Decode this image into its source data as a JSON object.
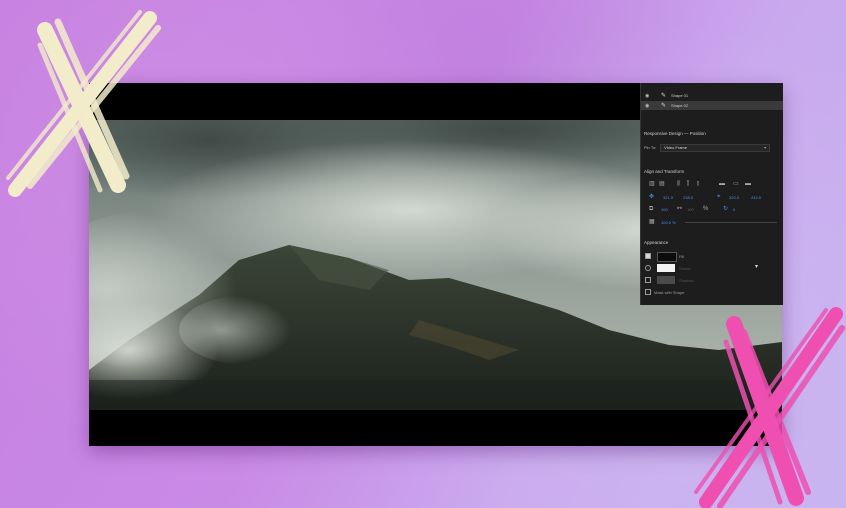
{
  "layers": [
    {
      "label": "Shape 01"
    },
    {
      "label": "Shape 02"
    }
  ],
  "responsive": {
    "title": "Responsive Design — Position",
    "pin_label": "Pin To:",
    "pin_value": "Video Frame"
  },
  "align": {
    "title": "Align and Transform",
    "pos_x": "321.9",
    "pos_y": "238.5",
    "anchor_x": "320.5",
    "anchor_y": "244.5",
    "width": "100",
    "height": "100",
    "rotation": "0",
    "opacity": "100.0 %"
  },
  "appearance": {
    "title": "Appearance",
    "fill_label": "Fill",
    "stroke_label": "Stroke",
    "shadow_label": "Shadow",
    "mask_label": "Mask with Shape"
  },
  "colors": {
    "background": "#c98ae6",
    "cream_x": "#f3eccb",
    "pink_x": "#ee4fb0",
    "panel": "#1d1d1d",
    "accent_blue": "#4d8cf0"
  }
}
